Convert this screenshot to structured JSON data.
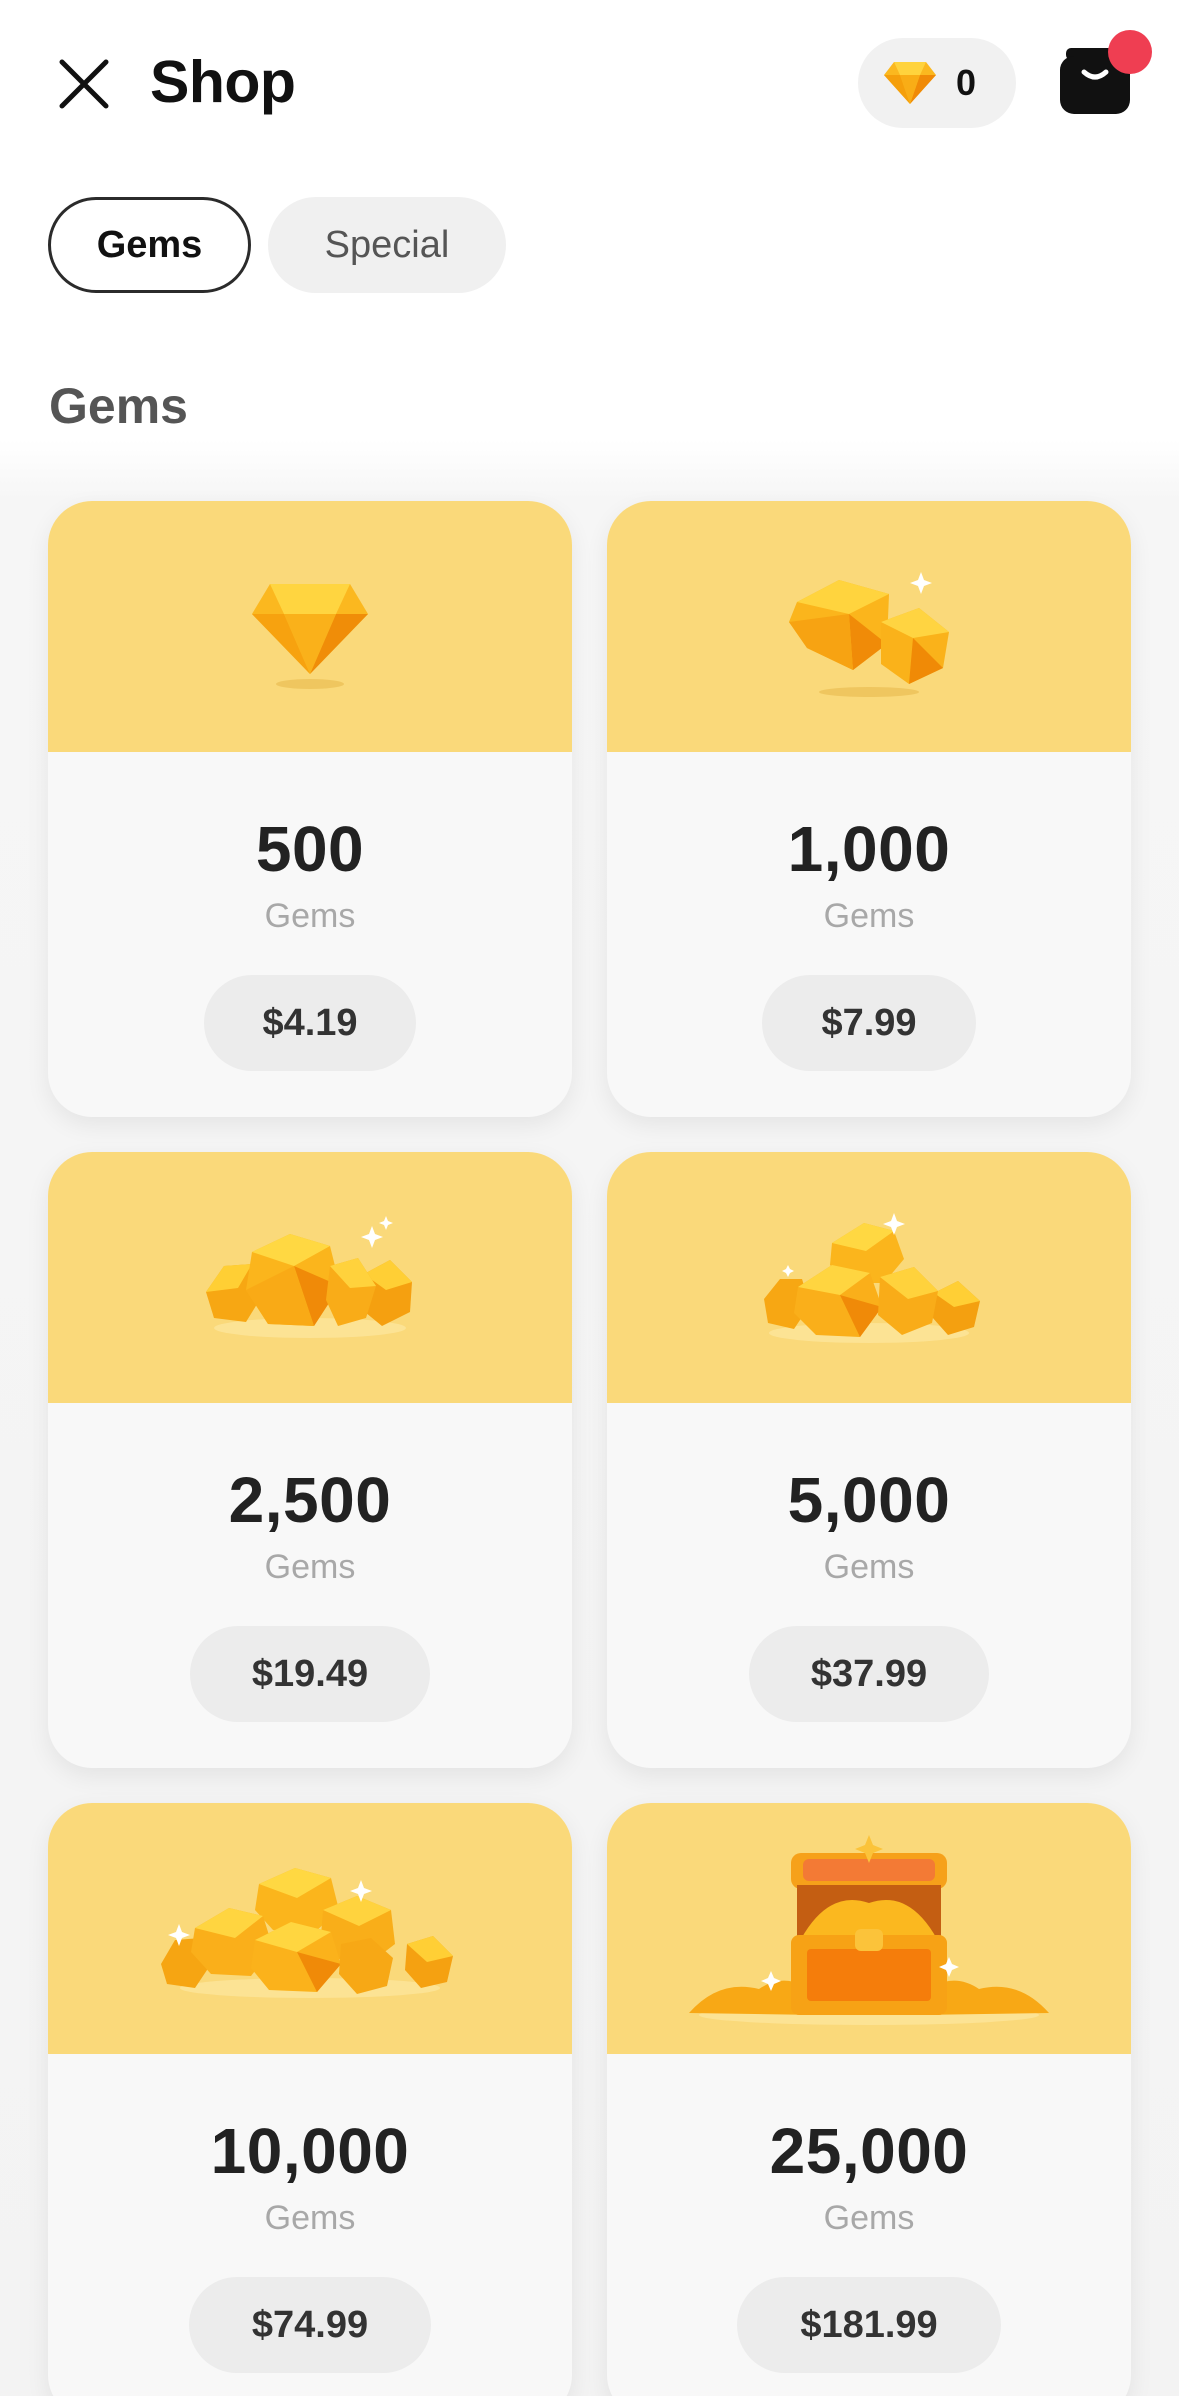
{
  "header": {
    "title": "Shop",
    "gem_balance": "0",
    "icons": {
      "close": "close-icon",
      "gem": "gem-icon",
      "cart": "shop-bag-icon",
      "notification": "notification-dot"
    }
  },
  "tabs": [
    {
      "label": "Gems",
      "selected": true
    },
    {
      "label": "Special",
      "selected": false
    }
  ],
  "section": {
    "title": "Gems"
  },
  "colors": {
    "accent": "#fad97a",
    "gem": "#fbb81f",
    "notification": "#ef3e52",
    "text": "#222222",
    "muted": "#a8a8a8"
  },
  "packs": [
    {
      "amount": "500",
      "unit": "Gems",
      "price": "$4.19",
      "image": "single-gem"
    },
    {
      "amount": "1,000",
      "unit": "Gems",
      "price": "$7.99",
      "image": "two-gems"
    },
    {
      "amount": "2,500",
      "unit": "Gems",
      "price": "$19.49",
      "image": "gem-cluster-small"
    },
    {
      "amount": "5,000",
      "unit": "Gems",
      "price": "$37.99",
      "image": "gem-cluster-medium"
    },
    {
      "amount": "10,000",
      "unit": "Gems",
      "price": "$74.99",
      "image": "gem-pile"
    },
    {
      "amount": "25,000",
      "unit": "Gems",
      "price": "$181.99",
      "image": "treasure-chest"
    }
  ]
}
